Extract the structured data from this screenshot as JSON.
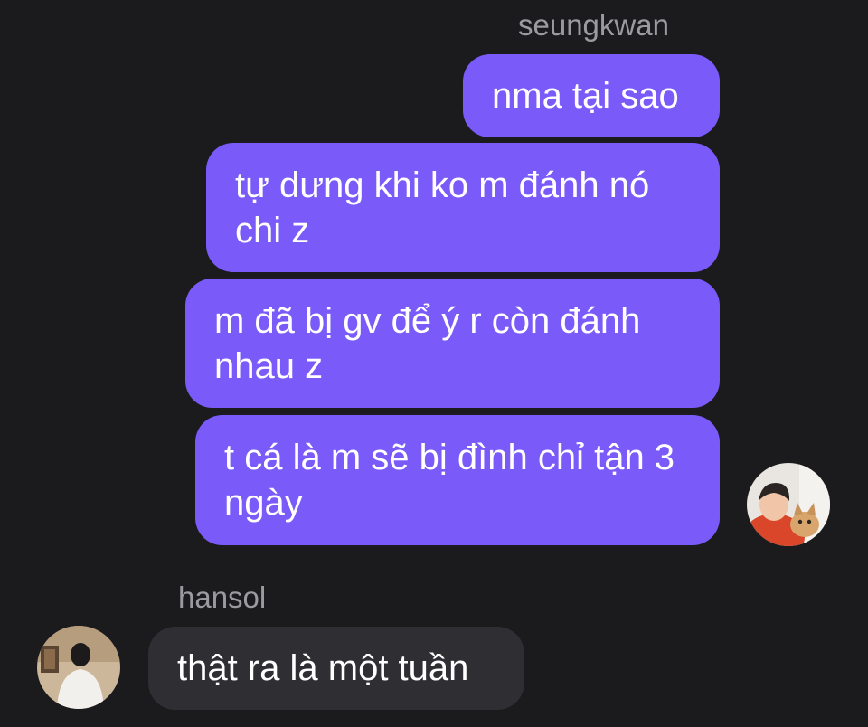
{
  "thread": {
    "outgoing_sender": "seungkwan",
    "incoming_sender": "hansol"
  },
  "messages": [
    {
      "from": "seungkwan",
      "text": "nma tại sao"
    },
    {
      "from": "seungkwan",
      "text": "tự dưng khi ko m đánh nó chi z"
    },
    {
      "from": "seungkwan",
      "text": "m đã bị gv để ý r còn đánh nhau z"
    },
    {
      "from": "seungkwan",
      "text": "t cá là m sẽ bị đình chỉ tận 3 ngày"
    },
    {
      "from": "hansol",
      "text": "thật ra là một tuần"
    }
  ],
  "colors": {
    "background": "#1b1b1d",
    "outgoing_bubble": "#7a5af8",
    "incoming_bubble": "#2f2f33",
    "sender_name": "#9a9a9f",
    "message_text": "#ffffff"
  },
  "icons": {
    "seungkwan_avatar": "avatar-photo-person-with-cat",
    "hansol_avatar": "avatar-photo-person-back-view"
  }
}
